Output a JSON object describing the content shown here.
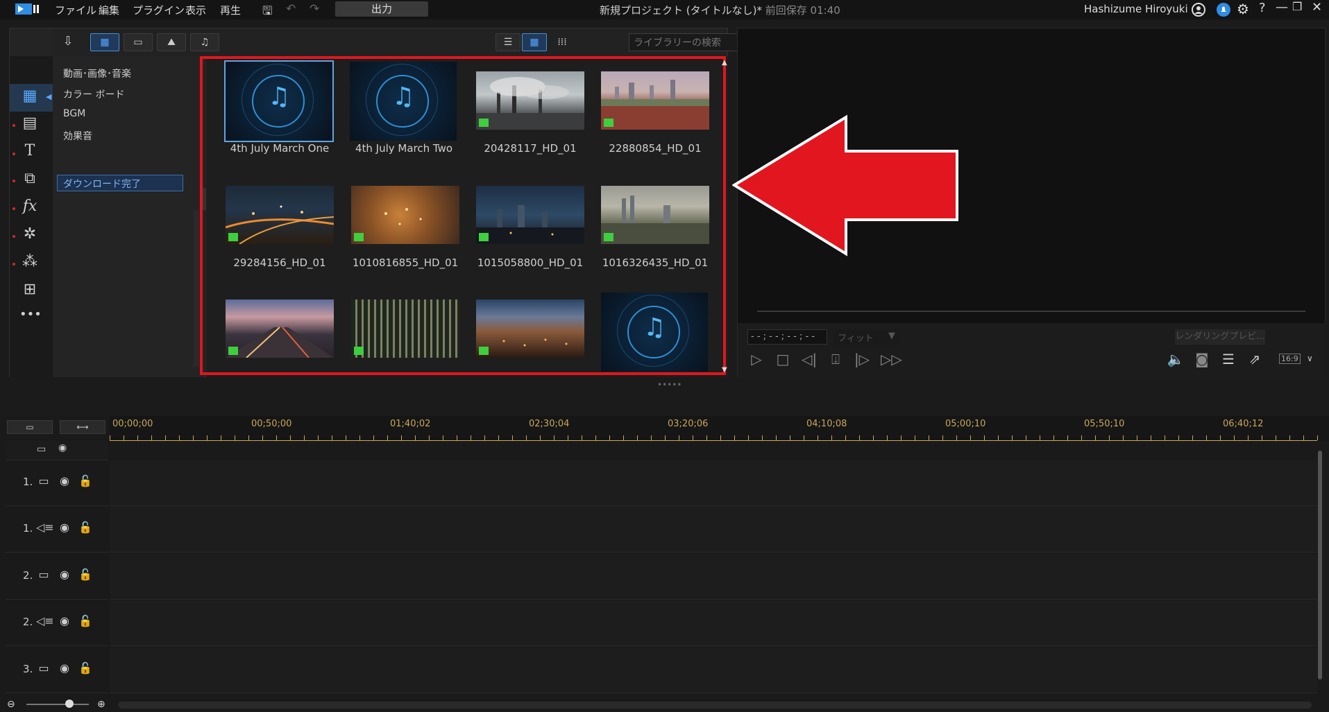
{
  "menu": {
    "items": [
      "ファイル",
      "編集",
      "プラグイン",
      "表示",
      "再生"
    ],
    "output_label": "出力"
  },
  "title": {
    "project": "新規プロジェクト (タイトルなし)*",
    "saved": "前回保存 01:40"
  },
  "user": {
    "name": "Hashizume Hiroyuki"
  },
  "library": {
    "search_placeholder": "ライブラリーの検索",
    "tree": [
      "動画･画像･音楽",
      "カラー ボード",
      "BGM",
      "効果音",
      "ダウンロード完了"
    ],
    "selected_tree_item": "ダウンロード完了",
    "media": [
      {
        "name": "4th July March One",
        "type": "music",
        "selected": true
      },
      {
        "name": "4th July March Two",
        "type": "music"
      },
      {
        "name": "20428117_HD_01",
        "type": "video"
      },
      {
        "name": "22880854_HD_01",
        "type": "video"
      },
      {
        "name": "29284156_HD_01",
        "type": "video"
      },
      {
        "name": "1010816855_HD_01",
        "type": "video"
      },
      {
        "name": "1015058800_HD_01",
        "type": "video"
      },
      {
        "name": "1016326435_HD_01",
        "type": "video"
      },
      {
        "name": "",
        "type": "video"
      },
      {
        "name": "",
        "type": "video"
      },
      {
        "name": "",
        "type": "video"
      },
      {
        "name": "",
        "type": "music"
      }
    ]
  },
  "preview": {
    "timecode": "- - ; - - ; - - ; - -",
    "fit": "フィット",
    "render_label": "レンダリングプレビ...",
    "aspect": "16:9"
  },
  "timeline": {
    "ruler_labels": [
      "00;00;00",
      "00;50;00",
      "01;40;02",
      "02;30;04",
      "03;20;06",
      "04;10;08",
      "05;00;10",
      "05;50;10",
      "06;40;12"
    ],
    "tracks": [
      {
        "num": "1.",
        "kind": "video"
      },
      {
        "num": "1.",
        "kind": "audio"
      },
      {
        "num": "2.",
        "kind": "video"
      },
      {
        "num": "2.",
        "kind": "audio"
      },
      {
        "num": "3.",
        "kind": "video"
      }
    ]
  },
  "colors": {
    "highlight_red": "#e2161f",
    "accent_blue": "#4a90d9",
    "ruler": "#c9a85a"
  }
}
